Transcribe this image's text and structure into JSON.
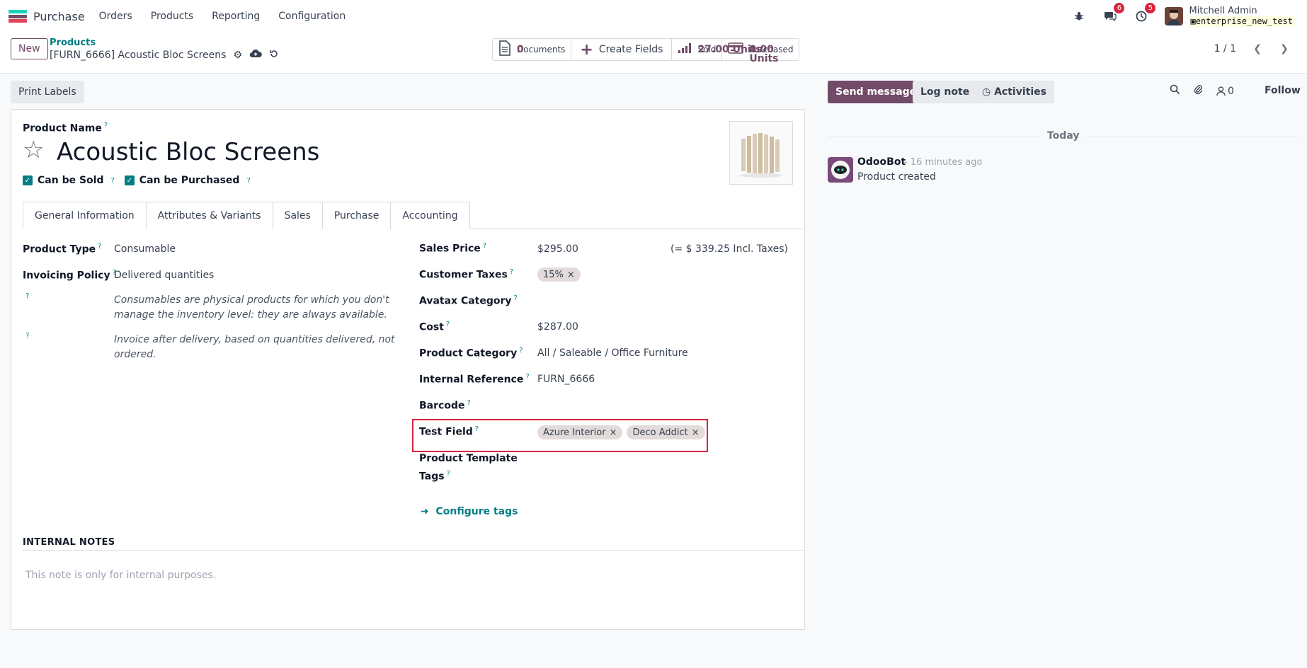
{
  "navbar": {
    "app_name": "Purchase",
    "menu": [
      "Orders",
      "Products",
      "Reporting",
      "Configuration"
    ],
    "messages_badge": "6",
    "activities_badge": "5",
    "user_name": "Mitchell Admin",
    "database": "enterprise_new_test"
  },
  "control": {
    "new_label": "New",
    "breadcrumb_parent": "Products",
    "breadcrumb_current": "[FURN_6666] Acoustic Bloc Screens",
    "stats": {
      "documents_label": "Documents",
      "documents_value": "0",
      "create_fields_label": "Create Fields",
      "sold_label": "Sold",
      "sold_value": "27.00 Units",
      "purchased_label": "Purchased",
      "purchased_value": "0.00 Units"
    },
    "pager": "1 / 1"
  },
  "form": {
    "print_labels": "Print Labels",
    "product_name_label": "Product Name",
    "product_name": "Acoustic Bloc Screens",
    "can_be_sold": "Can be Sold",
    "can_be_purchased": "Can be Purchased",
    "tabs": [
      "General Information",
      "Attributes & Variants",
      "Sales",
      "Purchase",
      "Accounting"
    ],
    "left": {
      "product_type_label": "Product Type",
      "product_type": "Consumable",
      "invoicing_policy_label": "Invoicing Policy",
      "invoicing_policy": "Delivered quantities",
      "help_consumable": "Consumables are physical products for which you don't manage the inventory level: they are always available.",
      "help_invoice": "Invoice after delivery, based on quantities delivered, not ordered."
    },
    "right": {
      "sales_price_label": "Sales Price",
      "sales_price": "$295.00",
      "sales_price_incl": "(= $ 339.25 Incl. Taxes)",
      "customer_taxes_label": "Customer Taxes",
      "customer_tax_tag": "15%",
      "avatax_label": "Avatax Category",
      "cost_label": "Cost",
      "cost": "$287.00",
      "category_label": "Product Category",
      "category": "All / Saleable / Office Furniture",
      "internal_ref_label": "Internal Reference",
      "internal_ref": "FURN_6666",
      "barcode_label": "Barcode",
      "test_field_label": "Test Field",
      "test_field_tags": [
        "Azure Interior",
        "Deco Addict"
      ],
      "template_tags_label_1": "Product Template",
      "template_tags_label_2": "Tags",
      "configure_tags": "Configure tags"
    },
    "notes_header": "INTERNAL NOTES",
    "notes_placeholder": "This note is only for internal purposes."
  },
  "chatter": {
    "send_message": "Send message",
    "log_note": "Log note",
    "activities": "Activities",
    "followers_count": "0",
    "follow": "Follow",
    "today": "Today",
    "author": "OdooBot",
    "time": "- 16 minutes ago",
    "message": "Product created"
  },
  "colors": {
    "brand": "#714b67",
    "link": "#017e84",
    "badge": "#d9253e",
    "highlight_box": "#d9253e"
  }
}
